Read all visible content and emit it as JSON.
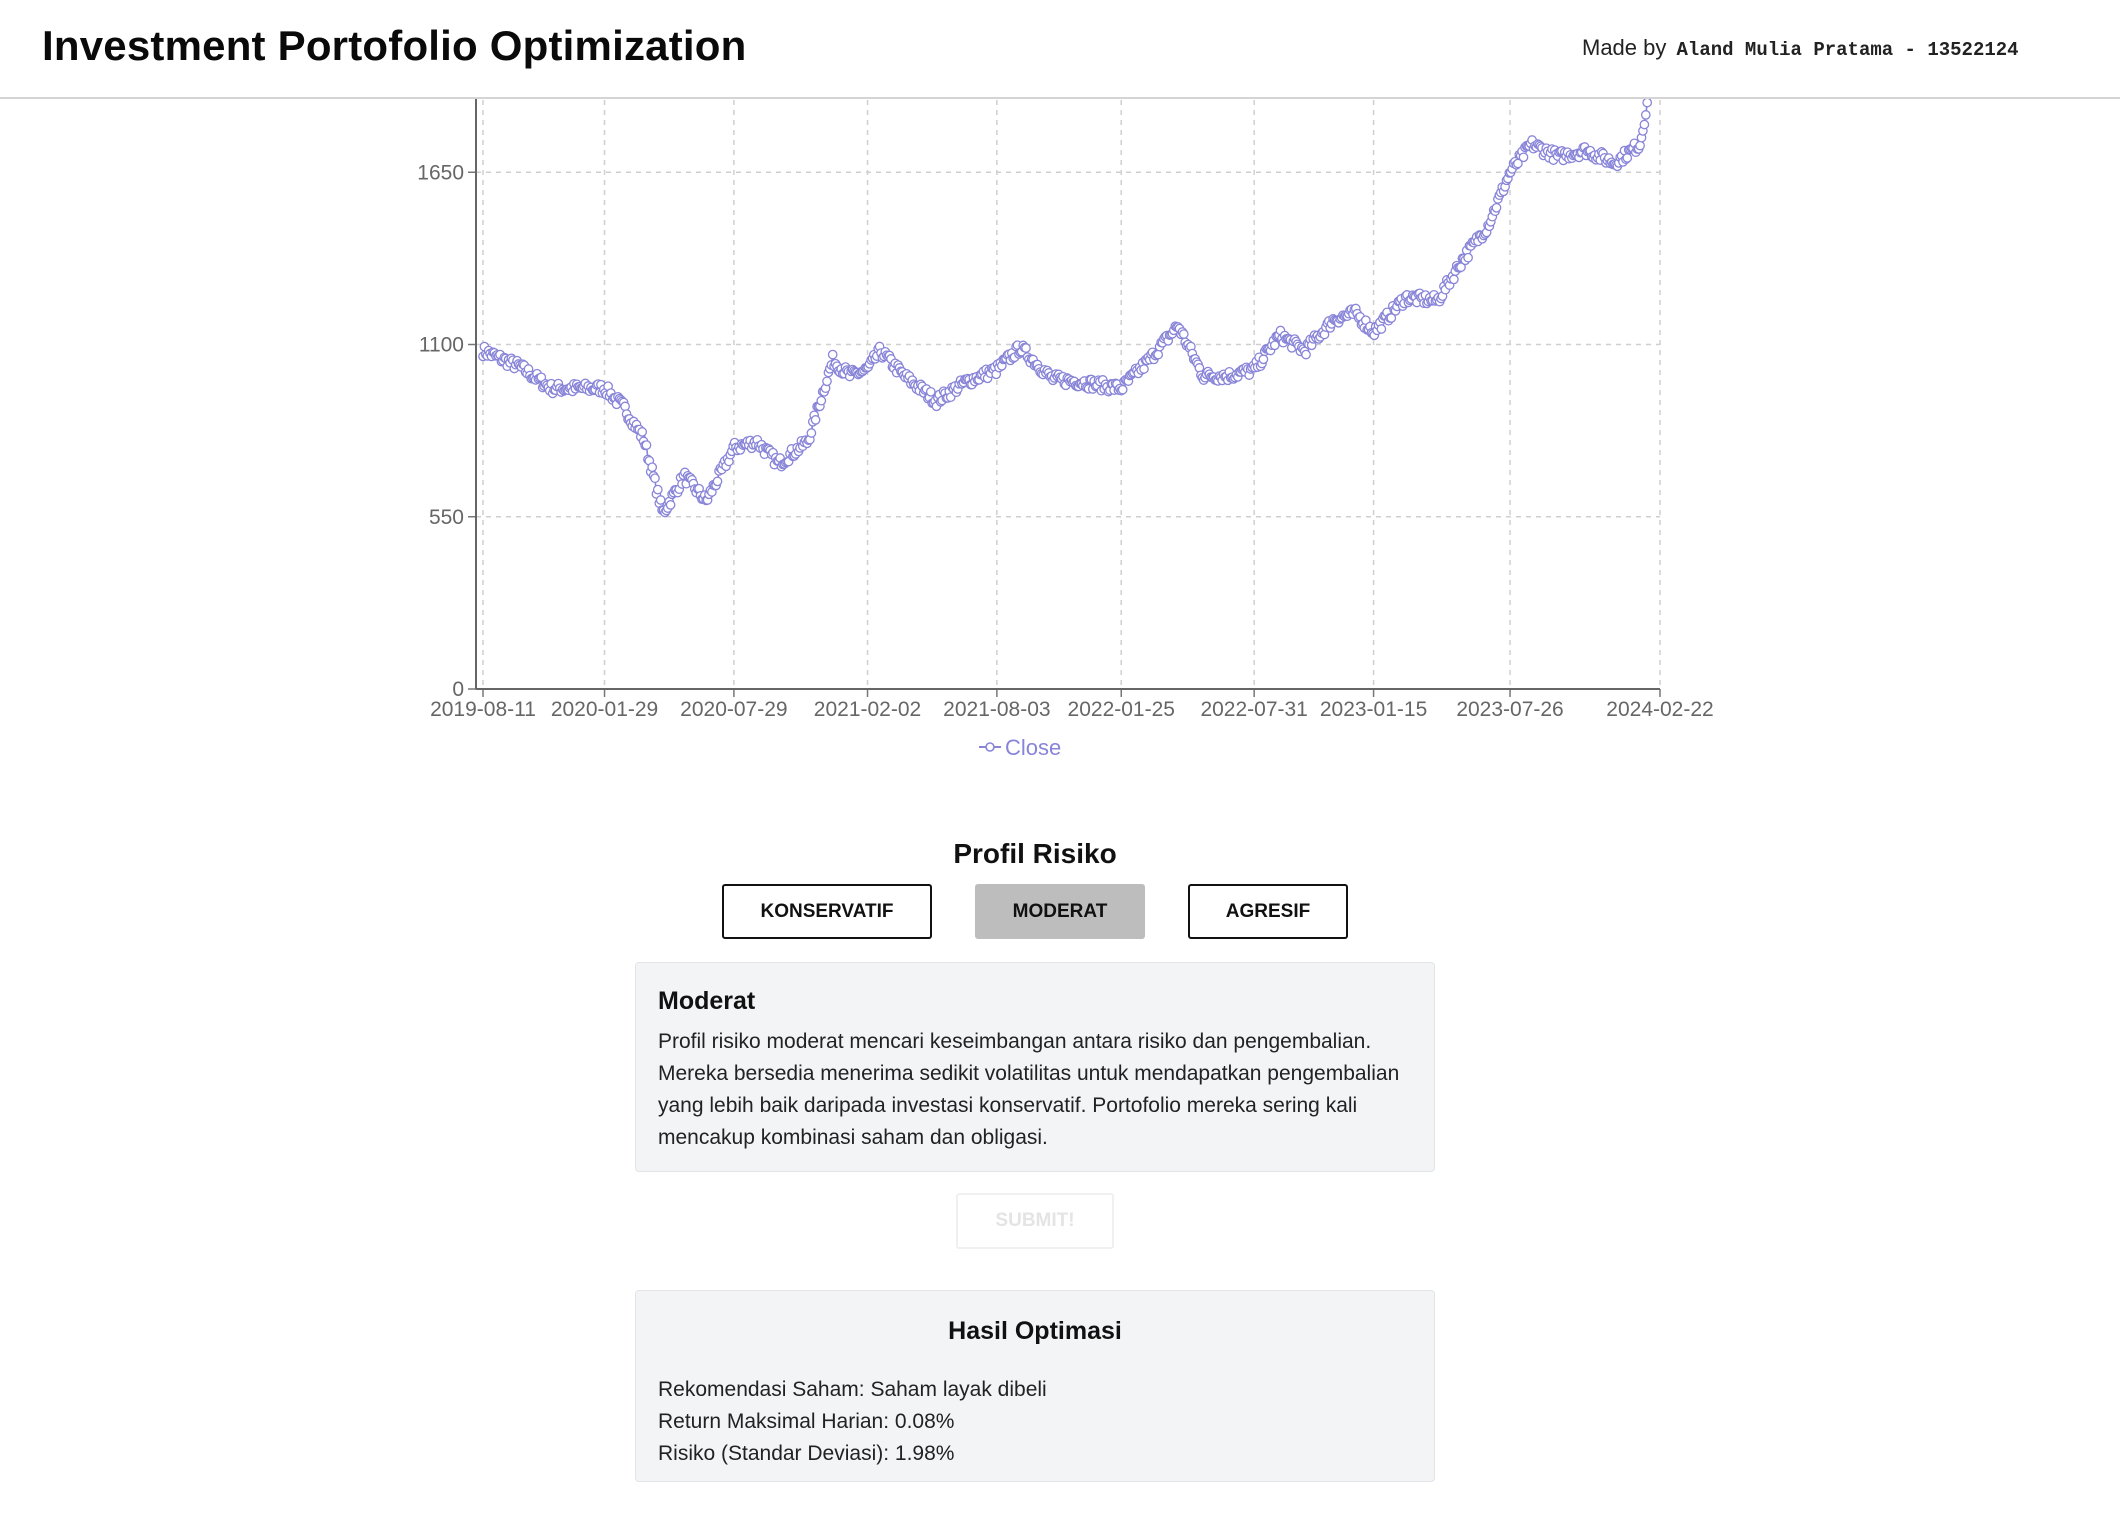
{
  "header": {
    "title": "Investment Portofolio Optimization",
    "credit_prefix": "Made by",
    "credit_author": "Aland Mulia Pratama - 13522124"
  },
  "chart_data": {
    "type": "line",
    "title": "",
    "xlabel": "",
    "ylabel": "",
    "ylim": [
      0,
      2200
    ],
    "y_ticks": [
      "0",
      "550",
      "1100",
      "1650"
    ],
    "x_ticks": [
      "2019-08-11",
      "2020-01-29",
      "2020-07-29",
      "2021-02-02",
      "2021-08-03",
      "2022-01-25",
      "2022-07-31",
      "2023-01-15",
      "2023-07-26",
      "2024-02-22"
    ],
    "grid": true,
    "legend": "bottom",
    "color": "#8884d8",
    "series": [
      {
        "name": "Close",
        "x": [
          "2019-08-11",
          "2019-10-01",
          "2019-11-15",
          "2020-01-29",
          "2020-02-25",
          "2020-03-24",
          "2020-04-20",
          "2020-05-20",
          "2020-06-20",
          "2020-07-29",
          "2020-08-30",
          "2020-09-30",
          "2020-11-10",
          "2020-12-15",
          "2021-01-08",
          "2021-02-02",
          "2021-02-20",
          "2021-03-25",
          "2021-05-10",
          "2021-06-20",
          "2021-08-03",
          "2021-09-05",
          "2021-10-20",
          "2021-11-30",
          "2022-01-25",
          "2022-03-05",
          "2022-04-15",
          "2022-05-20",
          "2022-06-25",
          "2022-07-31",
          "2022-09-05",
          "2022-10-10",
          "2022-11-20",
          "2022-12-20",
          "2023-01-15",
          "2023-03-01",
          "2023-04-15",
          "2023-05-20",
          "2023-06-25",
          "2023-07-26",
          "2023-08-25",
          "2023-10-01",
          "2023-11-10",
          "2023-12-20",
          "2024-01-25",
          "2024-02-22"
        ],
        "values": [
          1080,
          1030,
          960,
          960,
          900,
          800,
          560,
          680,
          600,
          770,
          790,
          720,
          790,
          1050,
          1000,
          1020,
          1080,
          1000,
          920,
          980,
          1020,
          1090,
          990,
          980,
          960,
          1050,
          1160,
          1000,
          1000,
          1020,
          1130,
          1080,
          1180,
          1200,
          1140,
          1250,
          1240,
          1370,
          1480,
          1650,
          1740,
          1700,
          1720,
          1680,
          1740,
          2110
        ]
      }
    ]
  },
  "risk_profile": {
    "heading": "Profil Risiko",
    "options": [
      "KONSERVATIF",
      "MODERAT",
      "AGRESIF"
    ],
    "selected": "MODERAT",
    "description_title": "Moderat",
    "description_text": "Profil risiko moderat mencari keseimbangan antara risiko dan pengembalian. Mereka bersedia menerima sedikit volatilitas untuk mendapatkan pengembalian yang lebih baik daripada investasi konservatif. Portofolio mereka sering kali mencakup kombinasi saham dan obligasi."
  },
  "submit": {
    "label": "SUBMIT!"
  },
  "result": {
    "title": "Hasil Optimasi",
    "recommendation": "Rekomendasi Saham: Saham layak dibeli",
    "max_return": "Return Maksimal Harian: 0.08%",
    "risk": "Risiko (Standar Deviasi): 1.98%"
  }
}
